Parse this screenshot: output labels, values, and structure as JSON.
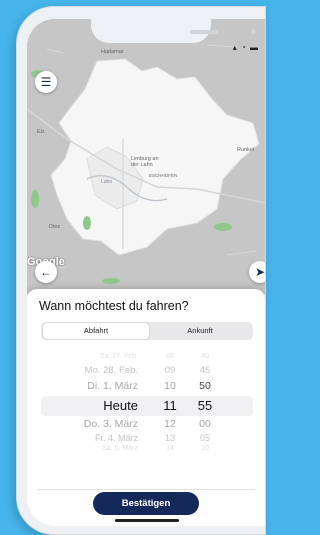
{
  "status": {
    "icons": "signal wifi battery"
  },
  "map": {
    "labels": {
      "hadamar": "Hadamar",
      "elz": "Elz",
      "runkel": "Runkel",
      "limburg": "Limburg an\nder Lahn",
      "eschhofen": "ESCHHOFEN",
      "lahn": "Lahn",
      "diez": "Diez"
    },
    "attribution": "Google"
  },
  "buttons": {
    "menu_icon": "menu-icon",
    "back_icon": "arrow-left-icon",
    "locate_icon": "navigation-arrow-icon"
  },
  "sheet": {
    "title": "Wann möchtest du fahren?",
    "tabs": [
      {
        "label": "Abfahrt",
        "selected": true
      },
      {
        "label": "Ankunft",
        "selected": false
      }
    ],
    "picker_rows": [
      {
        "day": "Sa. 27. Feb.",
        "hour": "08",
        "minute": "40"
      },
      {
        "day": "Mo. 28. Feb.",
        "hour": "09",
        "minute": "45"
      },
      {
        "day": "Di. 1. März",
        "hour": "10",
        "minute": "50"
      },
      {
        "day": "Heute",
        "hour": "11",
        "minute": "55"
      },
      {
        "day": "Do. 3. März",
        "hour": "12",
        "minute": "00"
      },
      {
        "day": "Fr. 4. März",
        "hour": "13",
        "minute": "05"
      },
      {
        "day": "Sa. 5. März",
        "hour": "14",
        "minute": "10"
      }
    ],
    "confirm_label": "Bestätigen"
  },
  "colors": {
    "brand": "#15285a",
    "background": "#45b5eb",
    "map_area": "#f7f7f7",
    "map_green": "#8ec98b"
  }
}
